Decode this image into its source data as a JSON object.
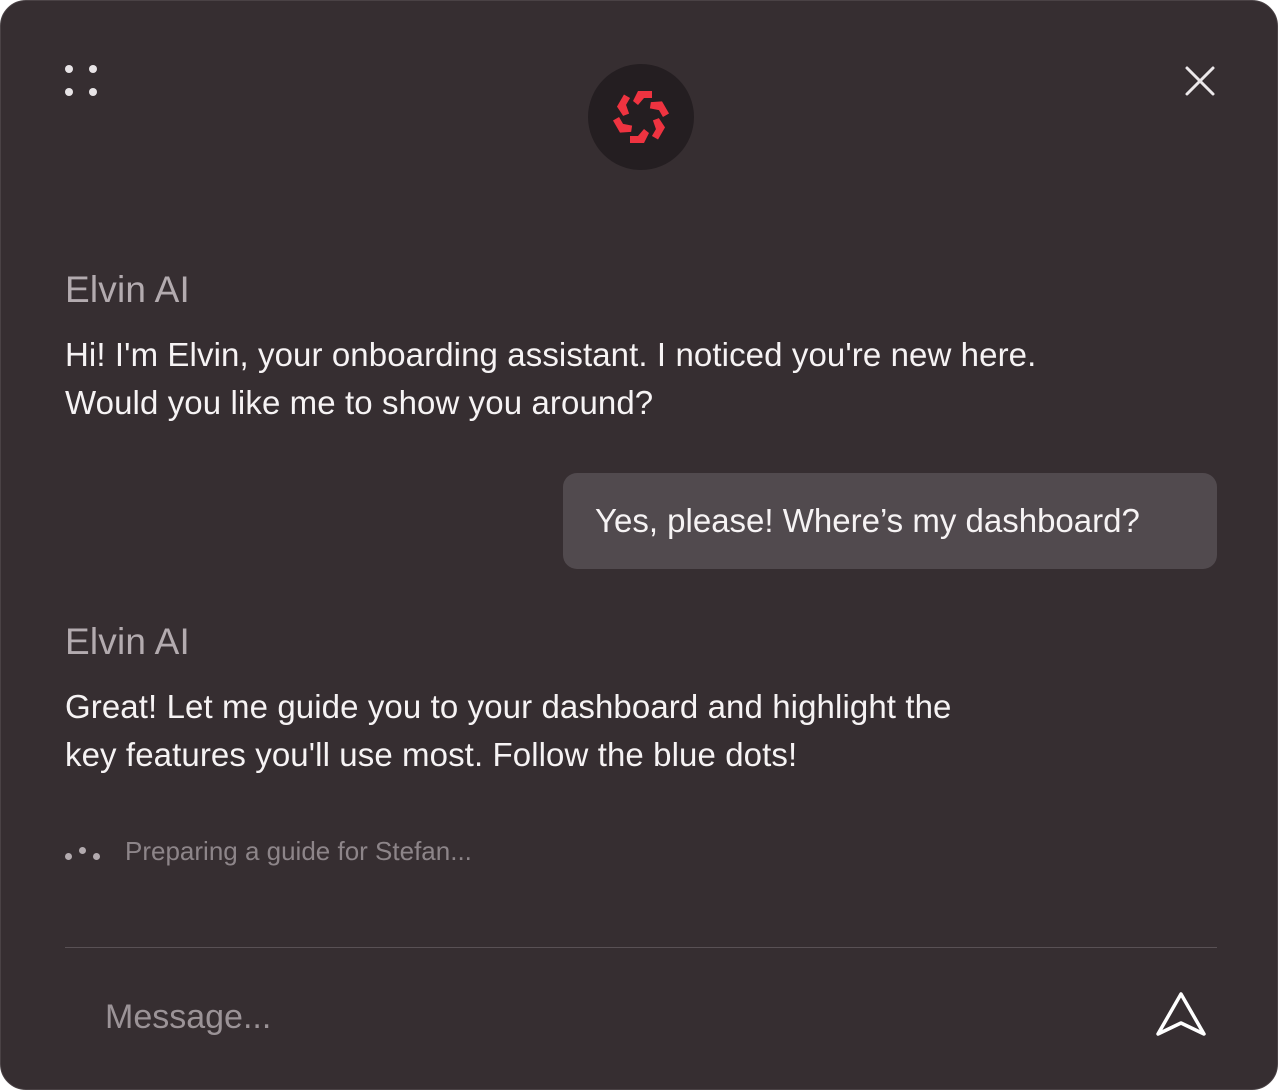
{
  "window": {
    "background": "#362e31",
    "brand_color": "#ef3340"
  },
  "header": {
    "drag_icon": "drag-handle-icon",
    "logo_icon": "hexagon-arrows-logo",
    "close_icon": "close-icon"
  },
  "messages": [
    {
      "sender": "Elvin AI",
      "text_lines": [
        "Hi! I'm Elvin, your onboarding assistant. I noticed you're new here.",
        "Would you like me to show you around?"
      ]
    },
    {
      "sender": "user",
      "text": "Yes, please! Where’s my dashboard?"
    },
    {
      "sender": "Elvin AI",
      "text_lines": [
        "Great! Let me guide you to your dashboard and highlight the",
        "key features you'll use most. Follow the blue dots!"
      ]
    }
  ],
  "status": {
    "typing_text": "Preparing a guide for Stefan..."
  },
  "composer": {
    "placeholder": "Message...",
    "value": "",
    "send_icon": "send-arrow-icon"
  }
}
